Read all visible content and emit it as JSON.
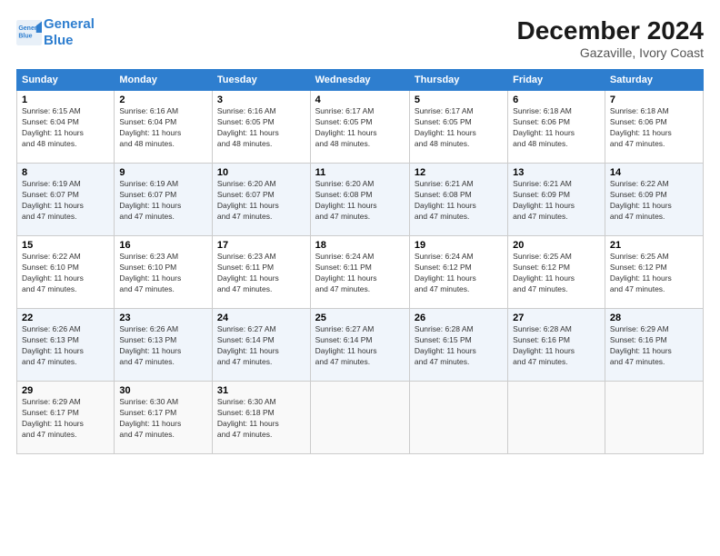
{
  "logo": {
    "line1": "General",
    "line2": "Blue"
  },
  "title": "December 2024",
  "subtitle": "Gazaville, Ivory Coast",
  "header_days": [
    "Sunday",
    "Monday",
    "Tuesday",
    "Wednesday",
    "Thursday",
    "Friday",
    "Saturday"
  ],
  "weeks": [
    [
      {
        "day": "1",
        "info": "Sunrise: 6:15 AM\nSunset: 6:04 PM\nDaylight: 11 hours\nand 48 minutes."
      },
      {
        "day": "2",
        "info": "Sunrise: 6:16 AM\nSunset: 6:04 PM\nDaylight: 11 hours\nand 48 minutes."
      },
      {
        "day": "3",
        "info": "Sunrise: 6:16 AM\nSunset: 6:05 PM\nDaylight: 11 hours\nand 48 minutes."
      },
      {
        "day": "4",
        "info": "Sunrise: 6:17 AM\nSunset: 6:05 PM\nDaylight: 11 hours\nand 48 minutes."
      },
      {
        "day": "5",
        "info": "Sunrise: 6:17 AM\nSunset: 6:05 PM\nDaylight: 11 hours\nand 48 minutes."
      },
      {
        "day": "6",
        "info": "Sunrise: 6:18 AM\nSunset: 6:06 PM\nDaylight: 11 hours\nand 48 minutes."
      },
      {
        "day": "7",
        "info": "Sunrise: 6:18 AM\nSunset: 6:06 PM\nDaylight: 11 hours\nand 47 minutes."
      }
    ],
    [
      {
        "day": "8",
        "info": "Sunrise: 6:19 AM\nSunset: 6:07 PM\nDaylight: 11 hours\nand 47 minutes."
      },
      {
        "day": "9",
        "info": "Sunrise: 6:19 AM\nSunset: 6:07 PM\nDaylight: 11 hours\nand 47 minutes."
      },
      {
        "day": "10",
        "info": "Sunrise: 6:20 AM\nSunset: 6:07 PM\nDaylight: 11 hours\nand 47 minutes."
      },
      {
        "day": "11",
        "info": "Sunrise: 6:20 AM\nSunset: 6:08 PM\nDaylight: 11 hours\nand 47 minutes."
      },
      {
        "day": "12",
        "info": "Sunrise: 6:21 AM\nSunset: 6:08 PM\nDaylight: 11 hours\nand 47 minutes."
      },
      {
        "day": "13",
        "info": "Sunrise: 6:21 AM\nSunset: 6:09 PM\nDaylight: 11 hours\nand 47 minutes."
      },
      {
        "day": "14",
        "info": "Sunrise: 6:22 AM\nSunset: 6:09 PM\nDaylight: 11 hours\nand 47 minutes."
      }
    ],
    [
      {
        "day": "15",
        "info": "Sunrise: 6:22 AM\nSunset: 6:10 PM\nDaylight: 11 hours\nand 47 minutes."
      },
      {
        "day": "16",
        "info": "Sunrise: 6:23 AM\nSunset: 6:10 PM\nDaylight: 11 hours\nand 47 minutes."
      },
      {
        "day": "17",
        "info": "Sunrise: 6:23 AM\nSunset: 6:11 PM\nDaylight: 11 hours\nand 47 minutes."
      },
      {
        "day": "18",
        "info": "Sunrise: 6:24 AM\nSunset: 6:11 PM\nDaylight: 11 hours\nand 47 minutes."
      },
      {
        "day": "19",
        "info": "Sunrise: 6:24 AM\nSunset: 6:12 PM\nDaylight: 11 hours\nand 47 minutes."
      },
      {
        "day": "20",
        "info": "Sunrise: 6:25 AM\nSunset: 6:12 PM\nDaylight: 11 hours\nand 47 minutes."
      },
      {
        "day": "21",
        "info": "Sunrise: 6:25 AM\nSunset: 6:12 PM\nDaylight: 11 hours\nand 47 minutes."
      }
    ],
    [
      {
        "day": "22",
        "info": "Sunrise: 6:26 AM\nSunset: 6:13 PM\nDaylight: 11 hours\nand 47 minutes."
      },
      {
        "day": "23",
        "info": "Sunrise: 6:26 AM\nSunset: 6:13 PM\nDaylight: 11 hours\nand 47 minutes."
      },
      {
        "day": "24",
        "info": "Sunrise: 6:27 AM\nSunset: 6:14 PM\nDaylight: 11 hours\nand 47 minutes."
      },
      {
        "day": "25",
        "info": "Sunrise: 6:27 AM\nSunset: 6:14 PM\nDaylight: 11 hours\nand 47 minutes."
      },
      {
        "day": "26",
        "info": "Sunrise: 6:28 AM\nSunset: 6:15 PM\nDaylight: 11 hours\nand 47 minutes."
      },
      {
        "day": "27",
        "info": "Sunrise: 6:28 AM\nSunset: 6:16 PM\nDaylight: 11 hours\nand 47 minutes."
      },
      {
        "day": "28",
        "info": "Sunrise: 6:29 AM\nSunset: 6:16 PM\nDaylight: 11 hours\nand 47 minutes."
      }
    ],
    [
      {
        "day": "29",
        "info": "Sunrise: 6:29 AM\nSunset: 6:17 PM\nDaylight: 11 hours\nand 47 minutes."
      },
      {
        "day": "30",
        "info": "Sunrise: 6:30 AM\nSunset: 6:17 PM\nDaylight: 11 hours\nand 47 minutes."
      },
      {
        "day": "31",
        "info": "Sunrise: 6:30 AM\nSunset: 6:18 PM\nDaylight: 11 hours\nand 47 minutes."
      },
      {
        "day": "",
        "info": ""
      },
      {
        "day": "",
        "info": ""
      },
      {
        "day": "",
        "info": ""
      },
      {
        "day": "",
        "info": ""
      }
    ]
  ]
}
